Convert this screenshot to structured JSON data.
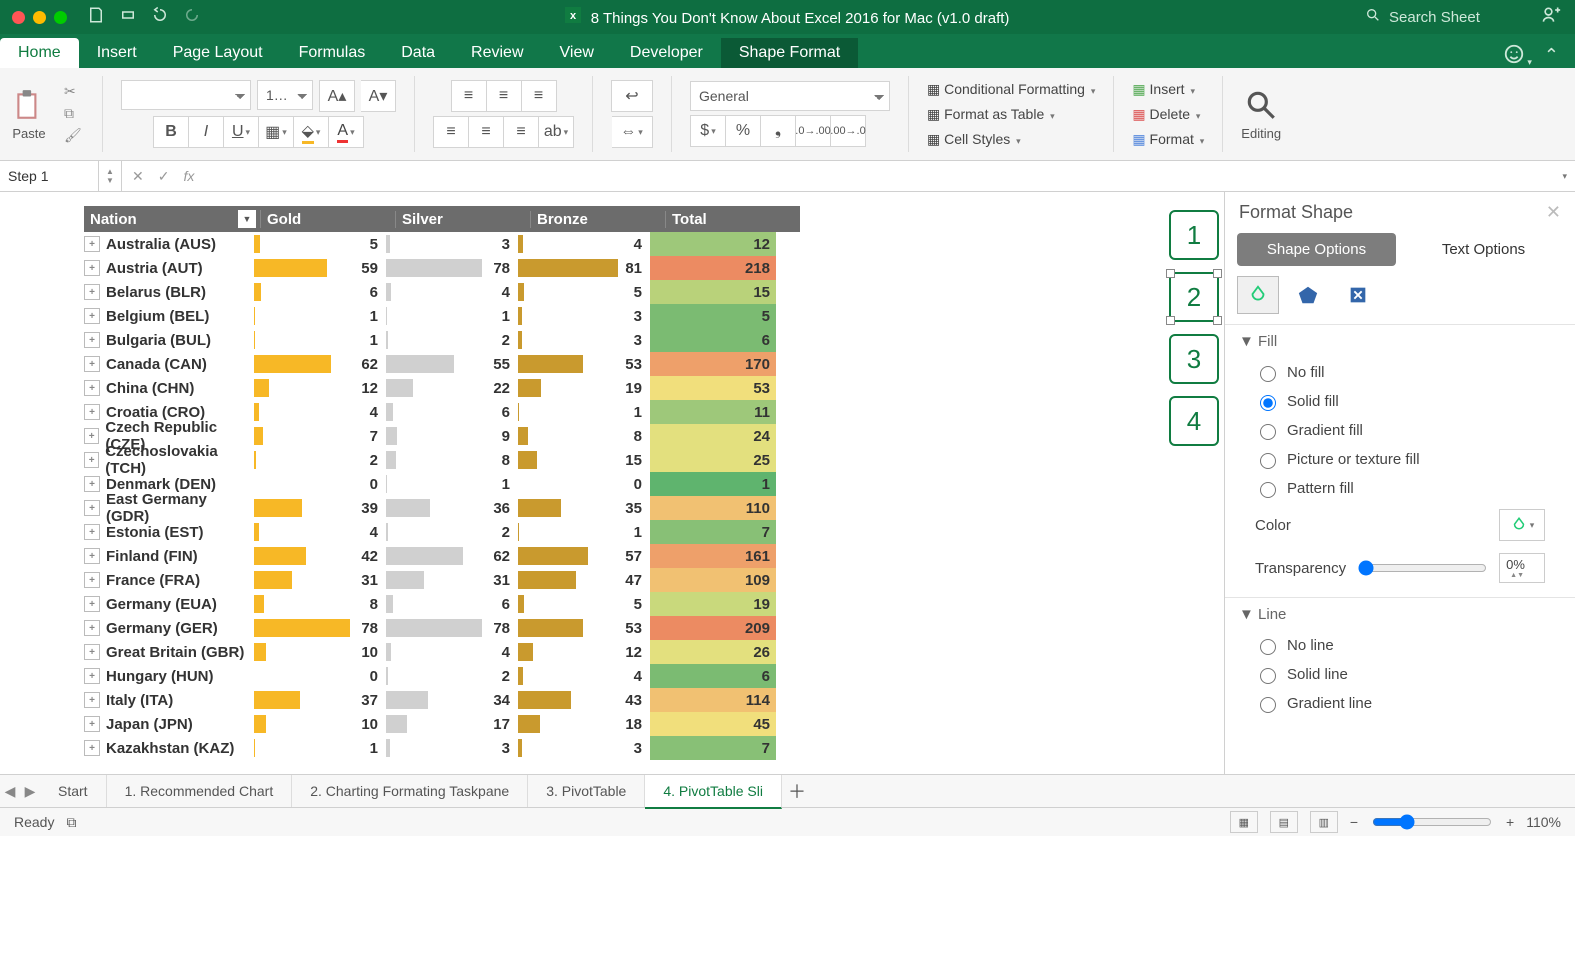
{
  "title": "8 Things You Don't Know About Excel 2016 for Mac (v1.0 draft)",
  "search_placeholder": "Search Sheet",
  "tabs": [
    "Home",
    "Insert",
    "Page Layout",
    "Formulas",
    "Data",
    "Review",
    "View",
    "Developer",
    "Shape Format"
  ],
  "active_tab": "Home",
  "paste_label": "Paste",
  "editing_label": "Editing",
  "font_size": "1…",
  "number_format": "General",
  "style_items": {
    "cond": "Conditional Formatting",
    "table": "Format as Table",
    "cell": "Cell Styles"
  },
  "cell_items": {
    "ins": "Insert",
    "del": "Delete",
    "fmt": "Format"
  },
  "namebox": "Step 1",
  "fx_label": "fx",
  "table": {
    "headers": {
      "nation": "Nation",
      "gold": "Gold",
      "silver": "Silver",
      "bronze": "Bronze",
      "total": "Total"
    },
    "max_medal": 81,
    "rows": [
      {
        "n": "Australia (AUS)",
        "g": 5,
        "s": 3,
        "b": 4,
        "t": 12,
        "c": "#9ec87a"
      },
      {
        "n": "Austria (AUT)",
        "g": 59,
        "s": 78,
        "b": 81,
        "t": 218,
        "c": "#ec8b62"
      },
      {
        "n": "Belarus (BLR)",
        "g": 6,
        "s": 4,
        "b": 5,
        "t": 15,
        "c": "#b9d27a"
      },
      {
        "n": "Belgium (BEL)",
        "g": 1,
        "s": 1,
        "b": 3,
        "t": 5,
        "c": "#7bbb72"
      },
      {
        "n": "Bulgaria (BUL)",
        "g": 1,
        "s": 2,
        "b": 3,
        "t": 6,
        "c": "#7bbb72"
      },
      {
        "n": "Canada (CAN)",
        "g": 62,
        "s": 55,
        "b": 53,
        "t": 170,
        "c": "#eea06a"
      },
      {
        "n": "China (CHN)",
        "g": 12,
        "s": 22,
        "b": 19,
        "t": 53,
        "c": "#f1df7c"
      },
      {
        "n": "Croatia (CRO)",
        "g": 4,
        "s": 6,
        "b": 1,
        "t": 11,
        "c": "#9ec87a"
      },
      {
        "n": "Czech Republic (CZE)",
        "g": 7,
        "s": 9,
        "b": 8,
        "t": 24,
        "c": "#e3e07e"
      },
      {
        "n": "Czechoslovakia (TCH)",
        "g": 2,
        "s": 8,
        "b": 15,
        "t": 25,
        "c": "#e3e07e"
      },
      {
        "n": "Denmark (DEN)",
        "g": 0,
        "s": 1,
        "b": 0,
        "t": 1,
        "c": "#5fb46e"
      },
      {
        "n": "East Germany (GDR)",
        "g": 39,
        "s": 36,
        "b": 35,
        "t": 110,
        "c": "#f1c172"
      },
      {
        "n": "Estonia (EST)",
        "g": 4,
        "s": 2,
        "b": 1,
        "t": 7,
        "c": "#88c076"
      },
      {
        "n": "Finland (FIN)",
        "g": 42,
        "s": 62,
        "b": 57,
        "t": 161,
        "c": "#eea06a"
      },
      {
        "n": "France (FRA)",
        "g": 31,
        "s": 31,
        "b": 47,
        "t": 109,
        "c": "#f1c172"
      },
      {
        "n": "Germany (EUA)",
        "g": 8,
        "s": 6,
        "b": 5,
        "t": 19,
        "c": "#c9d97c"
      },
      {
        "n": "Germany (GER)",
        "g": 78,
        "s": 78,
        "b": 53,
        "t": 209,
        "c": "#ec8b62"
      },
      {
        "n": "Great Britain (GBR)",
        "g": 10,
        "s": 4,
        "b": 12,
        "t": 26,
        "c": "#e3e07e"
      },
      {
        "n": "Hungary (HUN)",
        "g": 0,
        "s": 2,
        "b": 4,
        "t": 6,
        "c": "#7bbb72"
      },
      {
        "n": "Italy (ITA)",
        "g": 37,
        "s": 34,
        "b": 43,
        "t": 114,
        "c": "#f1c172"
      },
      {
        "n": "Japan (JPN)",
        "g": 10,
        "s": 17,
        "b": 18,
        "t": 45,
        "c": "#f1df7c"
      },
      {
        "n": "Kazakhstan (KAZ)",
        "g": 1,
        "s": 3,
        "b": 3,
        "t": 7,
        "c": "#88c076"
      }
    ]
  },
  "shapes": [
    "1",
    "2",
    "3",
    "4"
  ],
  "selected_shape_index": 1,
  "pane": {
    "title": "Format Shape",
    "tabs": {
      "shape": "Shape Options",
      "text": "Text Options"
    },
    "fill": {
      "title": "Fill",
      "opts": [
        "No fill",
        "Solid fill",
        "Gradient fill",
        "Picture or texture fill",
        "Pattern fill"
      ],
      "selected": 1,
      "color_label": "Color",
      "trans_label": "Transparency",
      "trans_val": "0%"
    },
    "line": {
      "title": "Line",
      "opts": [
        "No line",
        "Solid line",
        "Gradient line"
      ]
    }
  },
  "sheet_tabs": [
    "Start",
    "1. Recommended Chart",
    "2. Charting Formating Taskpane",
    "3. PivotTable",
    "4. PivotTable Sli"
  ],
  "active_sheet": 4,
  "status": {
    "ready": "Ready",
    "zoom": "110%"
  },
  "chart_data": {
    "type": "table",
    "note": "In-cell data bars + heatmap on Total column",
    "columns": [
      "Nation",
      "Gold",
      "Silver",
      "Bronze",
      "Total"
    ],
    "rows_ref": "table.rows"
  }
}
